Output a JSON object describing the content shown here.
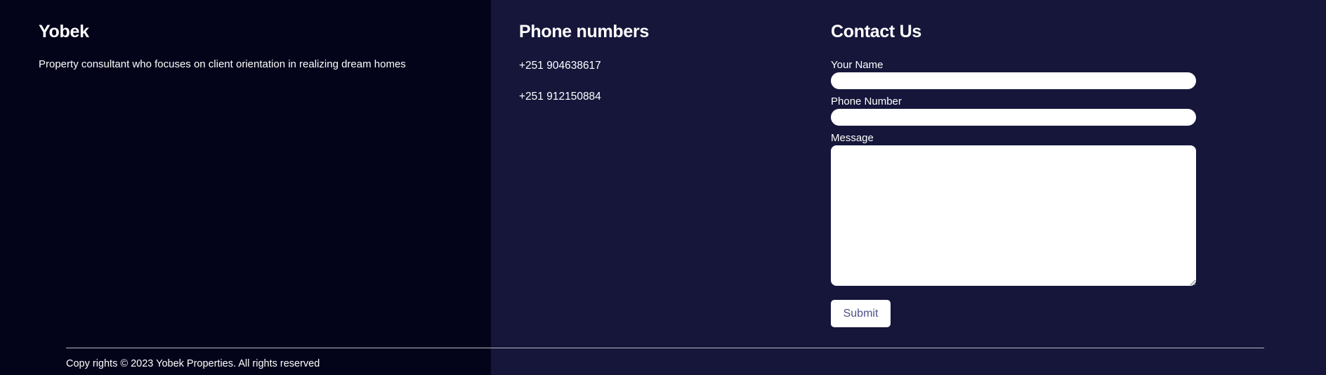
{
  "brand": {
    "title": "Yobek",
    "tagline": "Property consultant who focuses on client orientation in realizing dream homes"
  },
  "phones": {
    "heading": "Phone numbers",
    "numbers": [
      "+251 904638617",
      "+251 912150884"
    ]
  },
  "contact": {
    "heading": "Contact Us",
    "name_label": "Your Name",
    "name_value": "",
    "phone_label": "Phone Number",
    "phone_value": "",
    "message_label": "Message",
    "message_value": "",
    "submit_label": "Submit"
  },
  "footer": {
    "copyright": "Copy rights © 2023 Yobek Properties. All rights reserved"
  },
  "colors": {
    "left_panel_bg": "#03031a",
    "right_panel_bg": "#15163a",
    "text": "#ffffff",
    "submit_text": "#4b4f86"
  }
}
